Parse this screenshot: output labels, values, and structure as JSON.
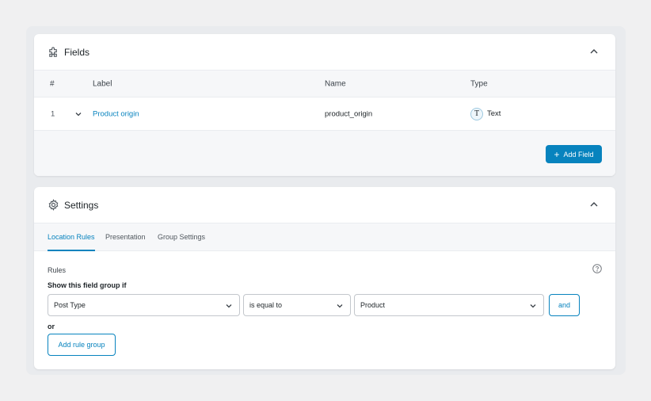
{
  "fields_panel": {
    "title": "Fields",
    "columns": {
      "num": "#",
      "label": "Label",
      "name": "Name",
      "type": "Type"
    },
    "rows": [
      {
        "num": "1",
        "label": "Product origin",
        "name": "product_origin",
        "type_glyph": "T",
        "type": "Text"
      }
    ],
    "add_field_label": "Add Field",
    "add_field_glyph": "+"
  },
  "settings_panel": {
    "title": "Settings",
    "tabs": [
      {
        "label": "Location Rules",
        "active": true
      },
      {
        "label": "Presentation",
        "active": false
      },
      {
        "label": "Group Settings",
        "active": false
      }
    ],
    "rules_label": "Rules",
    "show_if_label": "Show this field group if",
    "rule": {
      "param": "Post Type",
      "operator": "is equal to",
      "value": "Product"
    },
    "and_label": "and",
    "or_label": "or",
    "add_rule_group_label": "Add rule group"
  },
  "colors": {
    "accent": "#0783be",
    "background": "#f0f0f1"
  },
  "icons": {
    "fields": "puzzle-icon",
    "settings": "gear-icon",
    "collapse": "chevron-up-icon",
    "expand_row": "chevron-down-icon",
    "help": "help-icon",
    "dropdown": "chevron-down-icon"
  }
}
